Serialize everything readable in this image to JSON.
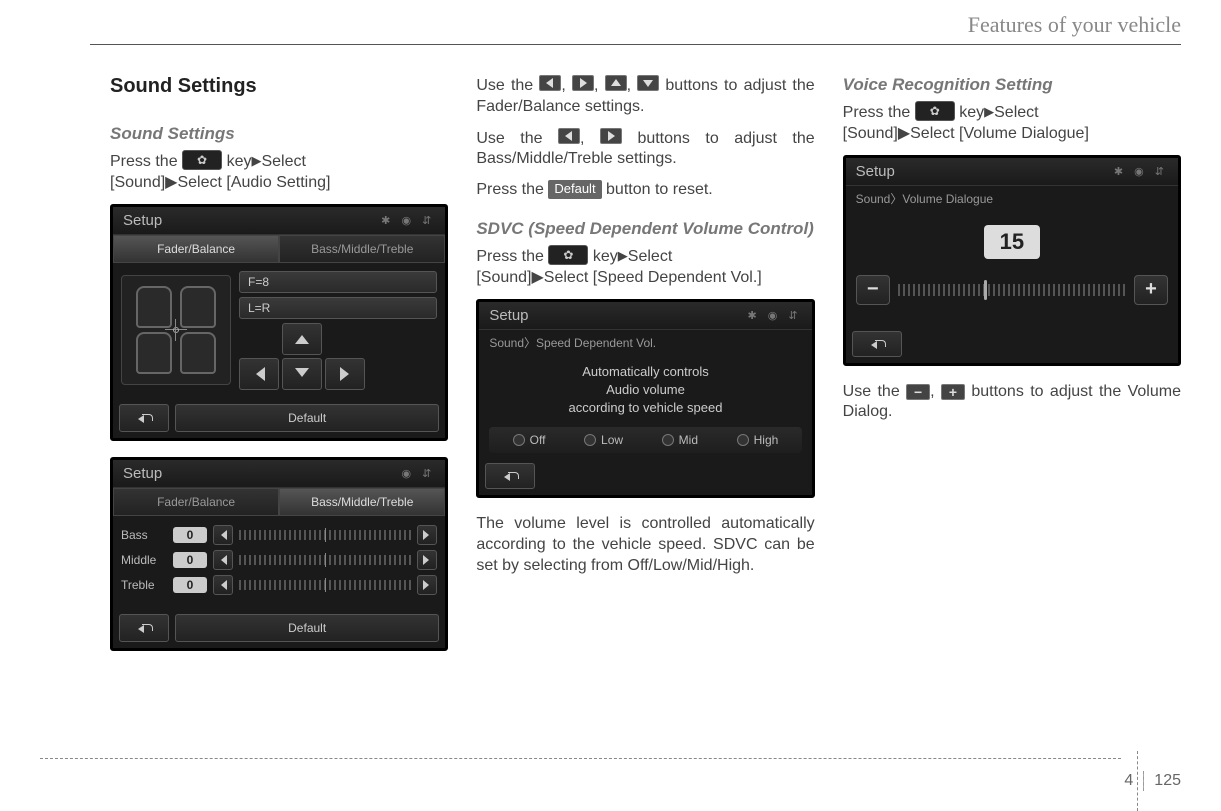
{
  "page": {
    "header": "Features of your vehicle",
    "section_number": "4",
    "page_number": "125"
  },
  "col1": {
    "h2": "Sound Settings",
    "h3": "Sound Settings",
    "press1": "Press the",
    "key_label": "key",
    "select": "Select",
    "path": "[Sound]▶Select [Audio Setting]",
    "screen1": {
      "title": "Setup",
      "tab1": "Fader/Balance",
      "tab2": "Bass/Middle/Treble",
      "fb": "F=8",
      "lr": "L=R",
      "default": "Default"
    },
    "screen2": {
      "title": "Setup",
      "tab1": "Fader/Balance",
      "tab2": "Bass/Middle/Treble",
      "bass_label": "Bass",
      "bass_val": "0",
      "mid_label": "Middle",
      "mid_val": "0",
      "treble_label": "Treble",
      "treble_val": "0",
      "default": "Default"
    }
  },
  "col2": {
    "p1a": "Use the ",
    "p1b": " buttons to adjust the Fader/Balance settings.",
    "p2a": "Use the ",
    "p2b": " buttons to adjust the Bass/Middle/Treble settings.",
    "p3a": "Press the ",
    "p3_default": "Default",
    "p3b": " button to reset.",
    "h3": "SDVC (Speed Dependent Volume Control)",
    "press1": "Press the",
    "key_label": "key",
    "select": "Select",
    "path": "[Sound]▶Select [Speed Dependent Vol.]",
    "screen": {
      "title": "Setup",
      "breadcrumb": "Sound〉Speed Dependent Vol.",
      "desc1": "Automatically controls",
      "desc2": "Audio volume",
      "desc3": "according to vehicle speed",
      "opt1": "Off",
      "opt2": "Low",
      "opt3": "Mid",
      "opt4": "High"
    },
    "p4": "The volume level is controlled automatically according to the vehicle speed. SDVC can be set by selecting from Off/Low/Mid/High."
  },
  "col3": {
    "h3": "Voice Recognition Setting",
    "press1": "Press the",
    "key_label": "key",
    "select": "Select",
    "path": "[Sound]▶Select [Volume Dialogue]",
    "screen": {
      "title": "Setup",
      "breadcrumb": "Sound〉Volume Dialogue",
      "value": "15"
    },
    "p1a": "Use the ",
    "p1b": " buttons to adjust the Volume Dialog."
  }
}
